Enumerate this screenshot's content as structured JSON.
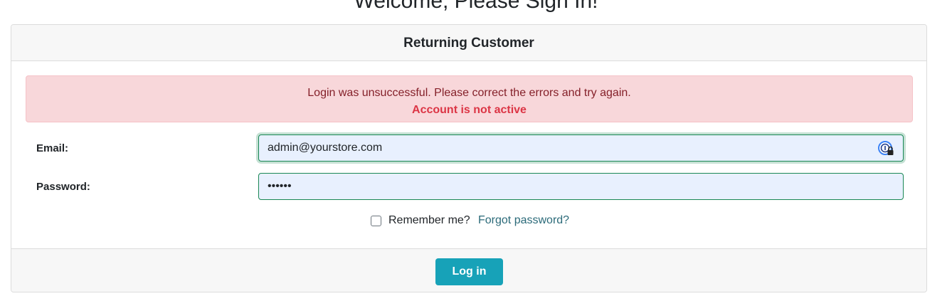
{
  "page": {
    "title": "Welcome, Please Sign In!"
  },
  "card": {
    "header": "Returning Customer"
  },
  "alert": {
    "message": "Login was unsuccessful. Please correct the errors and try again.",
    "error": "Account is not active"
  },
  "form": {
    "email_label": "Email:",
    "email_value": "admin@yourstore.com",
    "password_label": "Password:",
    "password_value": "••••••",
    "remember_label": "Remember me?",
    "remember_checked": false,
    "forgot_link": "Forgot password?"
  },
  "footer": {
    "login_label": "Log in"
  },
  "colors": {
    "alert_bg": "#f8d7da",
    "alert_error": "#dc3545",
    "input_bg": "#e8f0fe",
    "valid_border": "#198754",
    "button_bg": "#17a2b8",
    "link": "#2b6a79"
  },
  "icons": {
    "password_manager": "password-manager-icon"
  }
}
